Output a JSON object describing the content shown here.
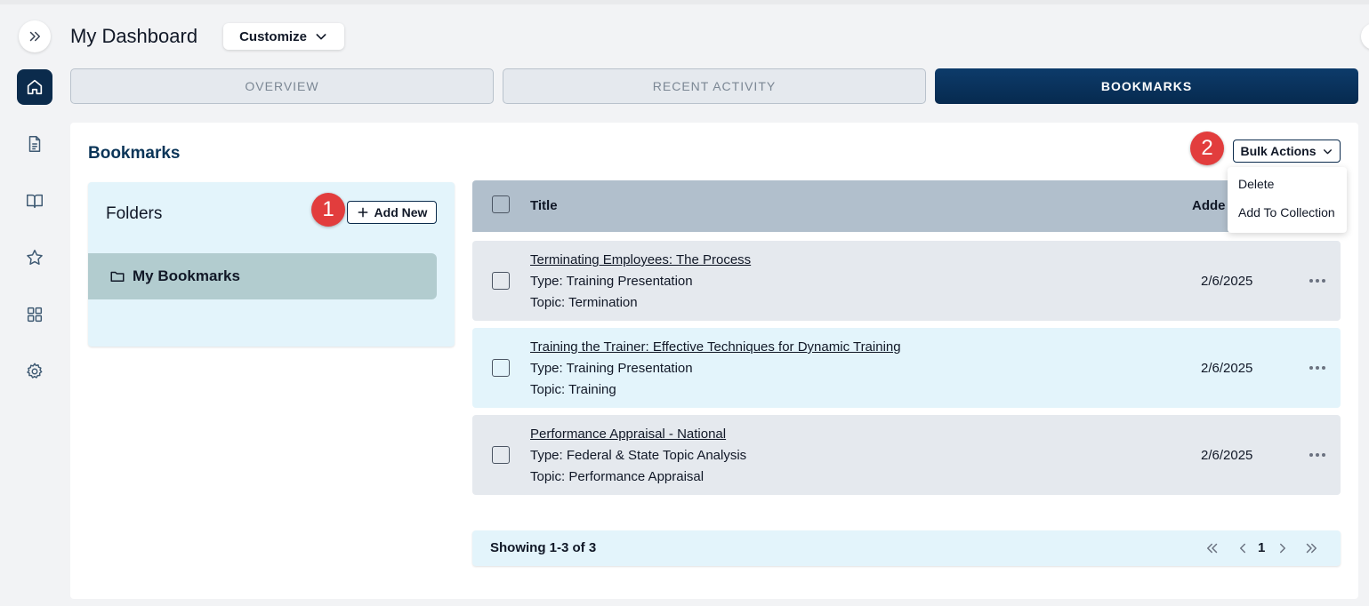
{
  "header": {
    "title": "My Dashboard",
    "customize_label": "Customize"
  },
  "tabs": [
    {
      "label": "OVERVIEW",
      "active": false
    },
    {
      "label": "RECENT ACTIVITY",
      "active": false
    },
    {
      "label": "BOOKMARKS",
      "active": true
    }
  ],
  "sidebar": {
    "items": [
      {
        "icon": "home-icon",
        "active": true
      },
      {
        "icon": "document-icon",
        "active": false
      },
      {
        "icon": "book-icon",
        "active": false
      },
      {
        "icon": "star-icon",
        "active": false
      },
      {
        "icon": "grid-icon",
        "active": false
      },
      {
        "icon": "gear-icon",
        "active": false
      }
    ]
  },
  "bookmarks": {
    "title": "Bookmarks",
    "bulk_actions_label": "Bulk Actions",
    "bulk_menu": [
      "Delete",
      "Add To Collection"
    ],
    "markers": [
      "1",
      "2"
    ]
  },
  "folders": {
    "title": "Folders",
    "add_new_label": "Add New",
    "items": [
      {
        "label": "My Bookmarks",
        "selected": true
      }
    ]
  },
  "table": {
    "headers": {
      "title": "Title",
      "added": "Adde"
    },
    "rows": [
      {
        "title": "Terminating Employees: The Process",
        "type": "Type: Training Presentation",
        "topic": "Topic: Termination",
        "date": "2/6/2025"
      },
      {
        "title": "Training the Trainer: Effective Techniques for Dynamic Training",
        "type": "Type: Training Presentation",
        "topic": "Topic: Training",
        "date": "2/6/2025"
      },
      {
        "title": "Performance Appraisal - National",
        "type": "Type: Federal & State Topic Analysis",
        "topic": "Topic: Performance Appraisal",
        "date": "2/6/2025"
      }
    ]
  },
  "pagination": {
    "showing": "Showing 1-3 of 3",
    "current_page": "1"
  },
  "colors": {
    "navy": "#0b2b4c",
    "light_blue": "#e3f4fb",
    "marker_red": "#e23d3d"
  }
}
